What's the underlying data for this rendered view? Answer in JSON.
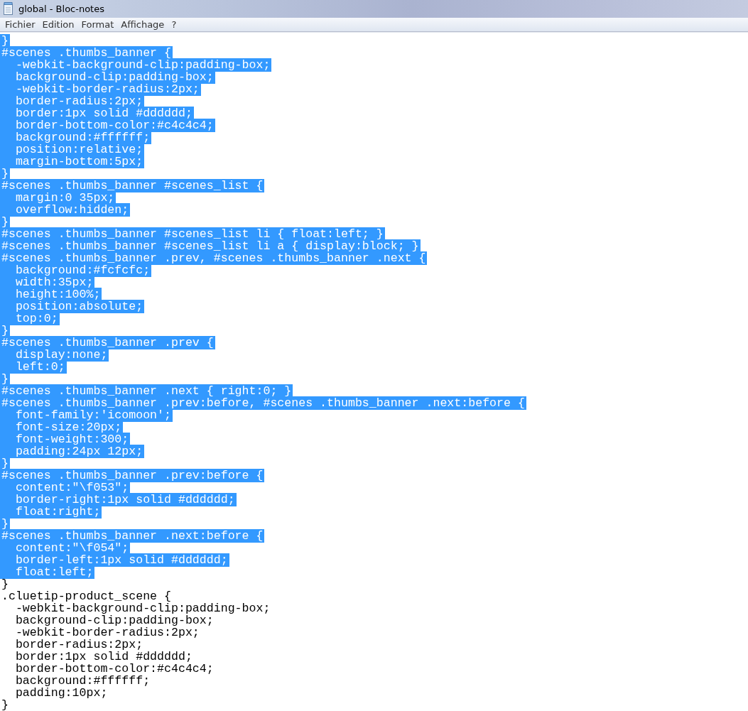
{
  "window": {
    "title": "global - Bloc-notes"
  },
  "menu": [
    "Fichier",
    "Edition",
    "Format",
    "Affichage",
    "?"
  ],
  "editor": {
    "lines": [
      {
        "text": "}",
        "selected": true
      },
      {
        "text": "#scenes .thumbs_banner {",
        "selected": true
      },
      {
        "text": "  -webkit-background-clip:padding-box;",
        "selected": true
      },
      {
        "text": "  background-clip:padding-box;",
        "selected": true
      },
      {
        "text": "  -webkit-border-radius:2px;",
        "selected": true
      },
      {
        "text": "  border-radius:2px;",
        "selected": true
      },
      {
        "text": "  border:1px solid #dddddd;",
        "selected": true
      },
      {
        "text": "  border-bottom-color:#c4c4c4;",
        "selected": true
      },
      {
        "text": "  background:#ffffff;",
        "selected": true
      },
      {
        "text": "  position:relative;",
        "selected": true
      },
      {
        "text": "  margin-bottom:5px;",
        "selected": true
      },
      {
        "text": "}",
        "selected": true
      },
      {
        "text": "#scenes .thumbs_banner #scenes_list {",
        "selected": true
      },
      {
        "text": "  margin:0 35px;",
        "selected": true
      },
      {
        "text": "  overflow:hidden;",
        "selected": true
      },
      {
        "text": "}",
        "selected": true
      },
      {
        "text": "#scenes .thumbs_banner #scenes_list li { float:left; }",
        "selected": true
      },
      {
        "text": "#scenes .thumbs_banner #scenes_list li a { display:block; }",
        "selected": true
      },
      {
        "text": "#scenes .thumbs_banner .prev, #scenes .thumbs_banner .next {",
        "selected": true
      },
      {
        "text": "  background:#fcfcfc;",
        "selected": true
      },
      {
        "text": "  width:35px;",
        "selected": true
      },
      {
        "text": "  height:100%;",
        "selected": true
      },
      {
        "text": "  position:absolute;",
        "selected": true
      },
      {
        "text": "  top:0;",
        "selected": true
      },
      {
        "text": "}",
        "selected": true
      },
      {
        "text": "#scenes .thumbs_banner .prev {",
        "selected": true
      },
      {
        "text": "  display:none;",
        "selected": true
      },
      {
        "text": "  left:0;",
        "selected": true
      },
      {
        "text": "}",
        "selected": true
      },
      {
        "text": "#scenes .thumbs_banner .next { right:0; }",
        "selected": true
      },
      {
        "text": "#scenes .thumbs_banner .prev:before, #scenes .thumbs_banner .next:before {",
        "selected": true
      },
      {
        "text": "  font-family:'icomoon';",
        "selected": true
      },
      {
        "text": "  font-size:20px;",
        "selected": true
      },
      {
        "text": "  font-weight:300;",
        "selected": true
      },
      {
        "text": "  padding:24px 12px;",
        "selected": true
      },
      {
        "text": "}",
        "selected": true
      },
      {
        "text": "#scenes .thumbs_banner .prev:before {",
        "selected": true
      },
      {
        "text": "  content:\"\\f053\";",
        "selected": true
      },
      {
        "text": "  border-right:1px solid #dddddd;",
        "selected": true
      },
      {
        "text": "  float:right;",
        "selected": true
      },
      {
        "text": "}",
        "selected": true
      },
      {
        "text": "#scenes .thumbs_banner .next:before {",
        "selected": true
      },
      {
        "text": "  content:\"\\f054\";",
        "selected": true
      },
      {
        "text": "  border-left:1px solid #dddddd;",
        "selected": true
      },
      {
        "text": "  float:left;",
        "selected": true
      },
      {
        "text": "}",
        "selected": false
      },
      {
        "text": ".cluetip-product_scene {",
        "selected": false
      },
      {
        "text": "  -webkit-background-clip:padding-box;",
        "selected": false
      },
      {
        "text": "  background-clip:padding-box;",
        "selected": false
      },
      {
        "text": "  -webkit-border-radius:2px;",
        "selected": false
      },
      {
        "text": "  border-radius:2px;",
        "selected": false
      },
      {
        "text": "  border:1px solid #dddddd;",
        "selected": false
      },
      {
        "text": "  border-bottom-color:#c4c4c4;",
        "selected": false
      },
      {
        "text": "  background:#ffffff;",
        "selected": false
      },
      {
        "text": "  padding:10px;",
        "selected": false
      },
      {
        "text": "}",
        "selected": false
      }
    ]
  }
}
